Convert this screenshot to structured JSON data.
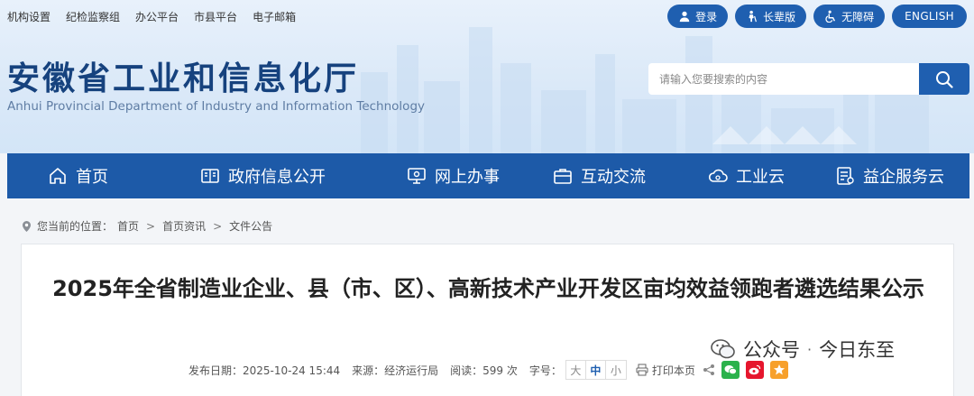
{
  "top_links": [
    "机构设置",
    "纪检监察组",
    "办公平台",
    "市县平台",
    "电子邮箱"
  ],
  "top_buttons": {
    "login": "登录",
    "elder": "长辈版",
    "accessibility": "无障碍",
    "english": "ENGLISH"
  },
  "brand": {
    "name_cn": "安徽省工业和信息化厅",
    "name_en": "Anhui Provincial Department of Industry and Information Technology"
  },
  "search": {
    "placeholder": "请输入您要搜索的内容"
  },
  "nav": [
    {
      "label": "首页",
      "icon": "home-icon"
    },
    {
      "label": "政府信息公开",
      "icon": "book-icon"
    },
    {
      "label": "网上办事",
      "icon": "monitor-icon"
    },
    {
      "label": "互动交流",
      "icon": "briefcase-icon"
    },
    {
      "label": "工业云",
      "icon": "cloud-icon"
    },
    {
      "label": "益企服务云",
      "icon": "document-icon"
    }
  ],
  "breadcrumb": {
    "prefix": "您当前的位置：",
    "items": [
      "首页",
      "首页资讯",
      "文件公告"
    ]
  },
  "article": {
    "title": "2025年全省制造业企业、县（市、区）、高新技术产业开发区亩均效益领跑者遴选结果公示",
    "publish_date": "发布日期：2025-10-24 15:44",
    "source": "来源：经济运行局",
    "reads": "阅读：599 次",
    "font_size_label": "字号：",
    "font_sizes": [
      "大",
      "中",
      "小"
    ],
    "print_label": "打印本页"
  },
  "watermark": {
    "prefix": "公众号",
    "separator": "·",
    "name": "今日东至"
  },
  "colors": {
    "brand_blue": "#1d5aa8",
    "wechat_green": "#2bb24c",
    "weibo_red": "#e6162d",
    "qzone_orange": "#f7a02b"
  }
}
